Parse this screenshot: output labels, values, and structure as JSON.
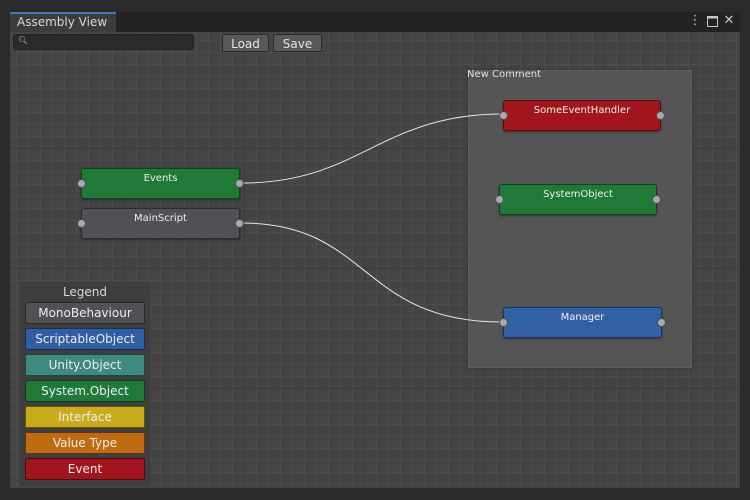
{
  "window": {
    "tab_title": "Assembly View",
    "menu_icon": "kebab-menu-icon",
    "maximize_icon": "maximize-icon",
    "close_icon": "close-icon"
  },
  "toolbar": {
    "search_value": "",
    "search_icon": "search-icon",
    "load_label": "Load",
    "save_label": "Save"
  },
  "comment": {
    "title": "New Comment"
  },
  "nodes": {
    "events": {
      "label": "Events",
      "color": "#1f7a39"
    },
    "mainscript": {
      "label": "MainScript",
      "color": "#4f5154"
    },
    "someeventhandler": {
      "label": "SomeEventHandler",
      "color": "#a3151c"
    },
    "systemobject": {
      "label": "SystemObject",
      "color": "#1f7a39"
    },
    "manager": {
      "label": "Manager",
      "color": "#3060a6"
    }
  },
  "legend": {
    "title": "Legend",
    "items": [
      {
        "label": "MonoBehaviour",
        "color": "#505154"
      },
      {
        "label": "ScriptableObject",
        "color": "#2f5ea4"
      },
      {
        "label": "Unity.Object",
        "color": "#3f8a7f"
      },
      {
        "label": "System.Object",
        "color": "#1f7a39"
      },
      {
        "label": "Interface",
        "color": "#c9ac1a"
      },
      {
        "label": "Value Type",
        "color": "#c06b12"
      },
      {
        "label": "Event",
        "color": "#a3151c"
      }
    ]
  }
}
